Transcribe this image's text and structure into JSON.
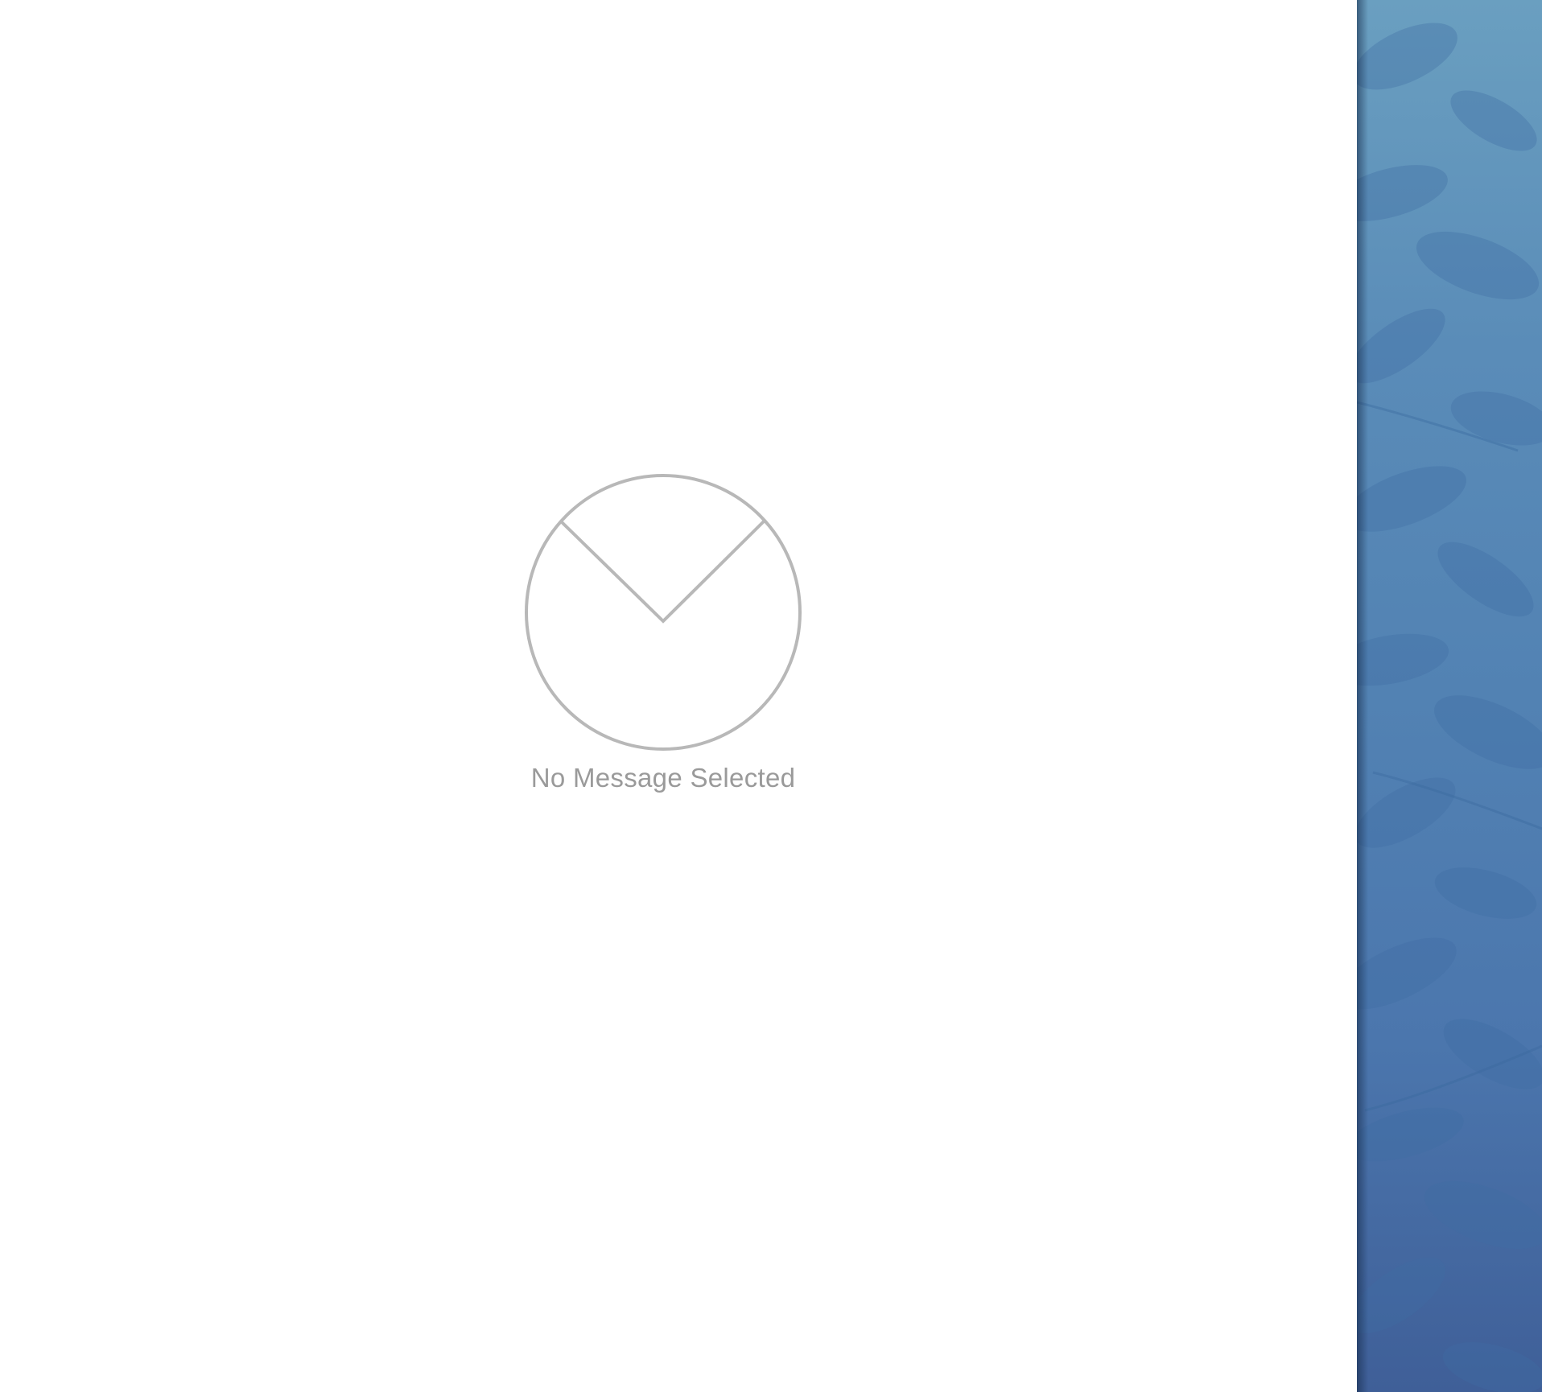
{
  "message_viewer": {
    "empty_state": {
      "icon": "envelope-outline-icon",
      "label": "No Message Selected",
      "label_color": "#9a9a9a",
      "icon_color": "#b8b8b8"
    }
  },
  "desktop": {
    "wallpaper": "blue-leaf-pattern",
    "colors": {
      "top": "#6a9fc0",
      "bottom": "#3f5f98"
    }
  }
}
